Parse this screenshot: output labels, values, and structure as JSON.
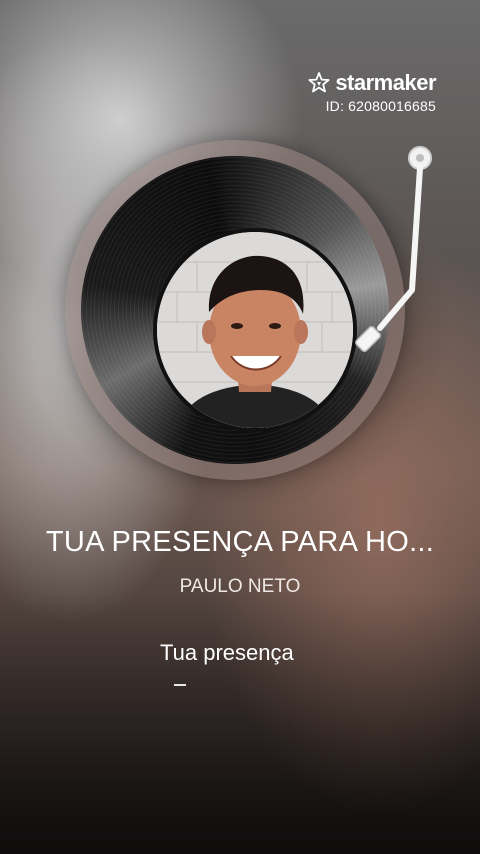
{
  "brand": {
    "name": "starmaker",
    "id_text": "ID: 62080016685",
    "icon": "starmaker-logo-icon"
  },
  "player": {
    "record_icon": "vinyl-record",
    "tonearm_icon": "tonearm-icon",
    "cover": "singer-photo"
  },
  "song": {
    "title": "TUA PRESENÇA PARA HO...",
    "artist": "PAULO NETO"
  },
  "lyrics": {
    "current_line": "Tua presença",
    "next_marker": "–"
  },
  "colors": {
    "text": "#ffffff",
    "record": "#111111"
  }
}
